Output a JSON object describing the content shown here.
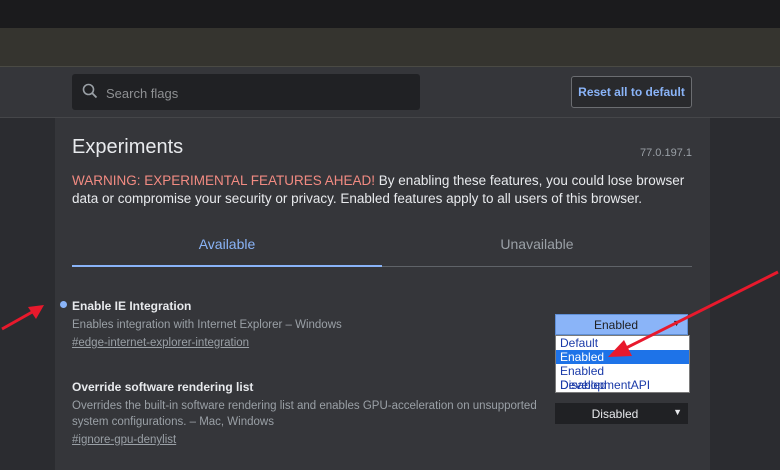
{
  "search": {
    "placeholder": "Search flags"
  },
  "header": {
    "reset_label": "Reset all to default"
  },
  "page": {
    "title": "Experiments",
    "version": "77.0.197.1",
    "warning_strong": "WARNING: EXPERIMENTAL FEATURES AHEAD!",
    "warning_rest": " By enabling these features, you could lose browser data or compromise your security or privacy. Enabled features apply to all users of this browser."
  },
  "tabs": [
    {
      "label": "Available",
      "active": true
    },
    {
      "label": "Unavailable",
      "active": false
    }
  ],
  "flags": [
    {
      "name": "Enable IE Integration",
      "description": "Enables integration with Internet Explorer – Windows",
      "link": "#edge-internet-explorer-integration",
      "value": "Enabled",
      "modified": true,
      "options": [
        "Default",
        "Enabled",
        "Enabled DevelopmentAPI",
        "Disabled"
      ],
      "highlighted_option": "Enabled"
    },
    {
      "name": "Override software rendering list",
      "description": "Overrides the built-in software rendering list and enables GPU-acceleration on unsupported system configurations. – Mac, Windows",
      "link": "#ignore-gpu-denylist",
      "value": "Disabled",
      "modified": false
    }
  ],
  "colors": {
    "accent": "#8ab4f8",
    "warning": "#f28b82",
    "annotation_arrow": "#e8192c",
    "background": "#35363a"
  }
}
